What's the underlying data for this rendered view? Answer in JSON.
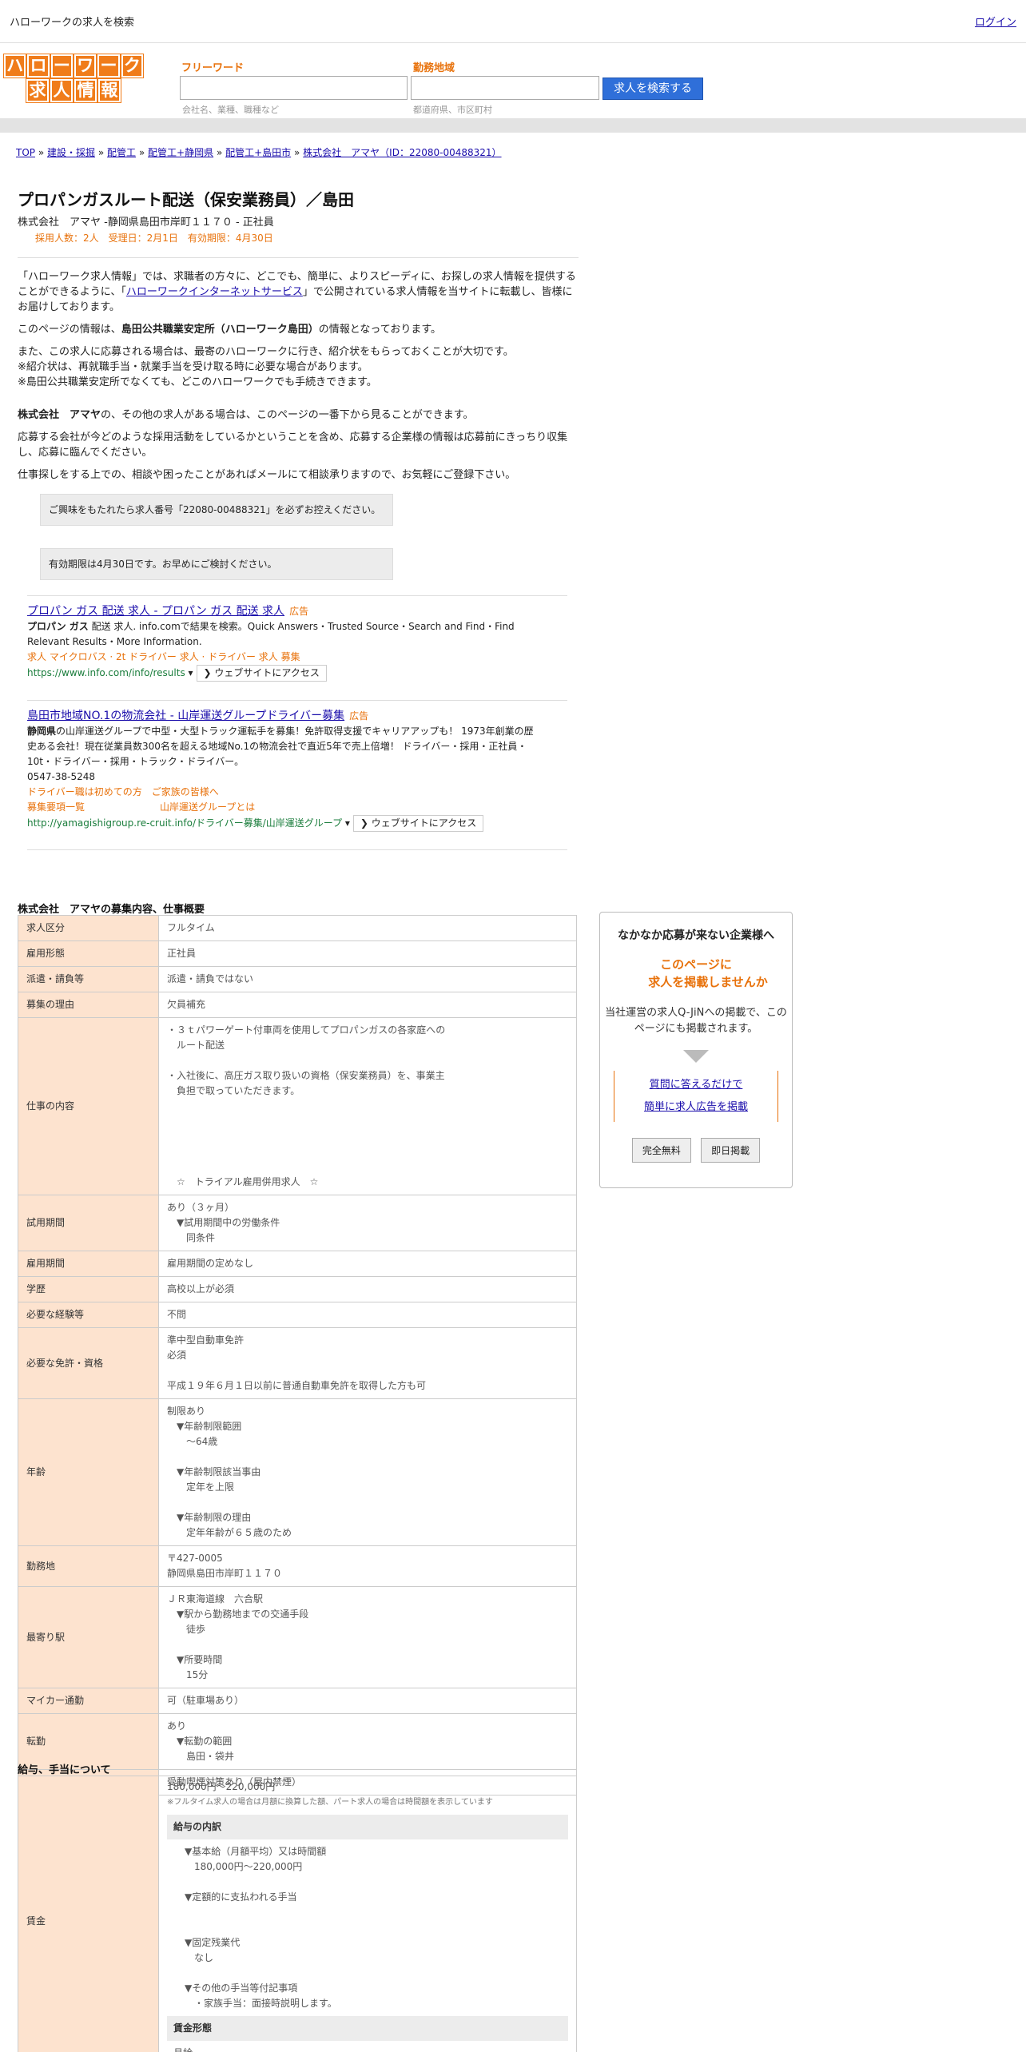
{
  "header": {
    "site_title": "ハローワークの求人を検索",
    "login": "ログイン"
  },
  "logo": {
    "line1": [
      "ハ",
      "ロ",
      "ー",
      "ワ",
      "ー",
      "ク"
    ],
    "line2": [
      "求",
      "人",
      "情",
      "報"
    ]
  },
  "search": {
    "keyword_label": "フリーワード",
    "keyword_hint": "会社名、業種、職種など",
    "area_label": "勤務地域",
    "area_hint": "都道府県、市区町村",
    "button": "求人を検索する"
  },
  "breadcrumb": {
    "items": [
      "TOP",
      "建設・採掘",
      "配管工",
      "配管工+静岡県",
      "配管工+島田市",
      "株式会社　アマヤ（ID：22080-00488321）"
    ],
    "sep": "»"
  },
  "job": {
    "title": "プロパンガスルート配送（保安業務員）／島田",
    "company_line": "株式会社　アマヤ -静岡県島田市岸町１１７０ - 正社員",
    "meta": "採用人数：2人　受理日：2月1日　有効期限：4月30日"
  },
  "intro": {
    "p1a": "「ハローワーク求人情報」では、求職者の方々に、どこでも、簡単に、よりスピーディに、お探しの求人情報を提供することができるように、「",
    "p1link": "ハローワークインターネットサービス",
    "p1b": "」で公開されている求人情報を当サイトに転載し、皆様にお届けしております。",
    "p2a": "このページの情報は、",
    "p2b": "島田公共職業安定所（ハローワーク島田）",
    "p2c": "の情報となっております。",
    "p3": "また、この求人に応募される場合は、最寄のハローワークに行き、紹介状をもらっておくことが大切です。\n※紹介状は、再就職手当・就業手当を受け取る時に必要な場合があります。\n※島田公共職業安定所でなくても、どこのハローワークでも手続きできます。",
    "p4a": "株式会社　アマヤ",
    "p4b": "の、その他の求人がある場合は、このページの一番下から見ることができます。",
    "p5": "応募する会社が今どのような採用活動をしているかということを含め、応募する企業様の情報は応募前にきっちり収集し、応募に臨んでください。",
    "p6": "仕事探しをする上での、相談や困ったことがあればメールにて相談承りますので、お気軽にご登録下さい。"
  },
  "notices": {
    "n1": "ご興味をもたれたら求人番号「22080-00488321」を必ずお控えください。",
    "n2": "有効期限は4月30日です。お早めにご検討ください。"
  },
  "ads": [
    {
      "title": "プロパン ガス 配送 求人 - プロパン ガス 配送 求人",
      "tag": "広告",
      "desc_bold": "プロパン ガス",
      "desc": " 配送 求人. info.comで結果を検索。Quick Answers・Trusted Source・Search and Find・Find Relevant Results・More Information.",
      "links": "求人 マイクロバス · 2t ドライバー 求人 · ドライバー 求人 募集",
      "url": "https://www.info.com/info/results",
      "visit": "❯ ウェブサイトにアクセス"
    },
    {
      "title": "島田市地域NO.1の物流会社 - 山岸運送グループドライバー募集",
      "tag": "広告",
      "desc_bold": "静岡県",
      "desc": "の山岸運送グループで中型・大型トラック運転手を募集！免許取得支援でキャリアアップも！ 1973年創業の歴史ある会社！現在従業員数300名を超える地域No.1の物流会社で直近5年で売上倍増！ ドライバー・採用・正社員・10t・ドライバー・採用・トラック・ドライバー。",
      "phone": "0547-38-5248",
      "sub1": "ドライバー職は初めての方",
      "sub2": "ご家族の皆様へ",
      "sub3": "募集要項一覧",
      "sub4": "山岸運送グループとは",
      "url": "http://yamagishigroup.re-cruit.info/ドライバー募集/山岸運送グループ",
      "visit": "❯ ウェブサイトにアクセス"
    }
  ],
  "details": {
    "section_title": "株式会社　アマヤの募集内容、仕事概要",
    "rows": [
      {
        "k": "求人区分",
        "v": "フルタイム"
      },
      {
        "k": "雇用形態",
        "v": "正社員"
      },
      {
        "k": "派遣・請負等",
        "v": "派遣・請負ではない"
      },
      {
        "k": "募集の理由",
        "v": "欠員補充"
      },
      {
        "k": "仕事の内容",
        "v": "・３ｔパワーゲート付車両を使用してプロパンガスの各家庭への\n　ルート配送\n\n・入社後に、高圧ガス取り扱いの資格（保安業務員）を、事業主\n　負担で取っていただきます。\n\n\n\n\n\n　☆　トライアル雇用併用求人　☆"
      },
      {
        "k": "試用期間",
        "v": "あり（３ヶ月）\n　▼試用期間中の労働条件\n　　同条件"
      },
      {
        "k": "雇用期間",
        "v": "雇用期間の定めなし"
      },
      {
        "k": "学歴",
        "v": "高校以上が必須"
      },
      {
        "k": "必要な経験等",
        "v": "不問"
      },
      {
        "k": "必要な免許・資格",
        "v": "準中型自動車免許\n必須\n\n平成１９年６月１日以前に普通自動車免許を取得した方も可"
      },
      {
        "k": "年齢",
        "v": "制限あり\n　▼年齢制限範囲\n　　〜64歳\n\n　▼年齢制限該当事由\n　　定年を上限\n\n　▼年齢制限の理由\n　　定年年齢が６５歳のため"
      },
      {
        "k": "勤務地",
        "v": "〒427-0005\n静岡県島田市岸町１１７０"
      },
      {
        "k": "最寄り駅",
        "v": "ＪＲ東海道線　六合駅\n　▼駅から勤務地までの交通手段\n　　徒歩\n\n　▼所要時間\n　　15分"
      },
      {
        "k": "マイカー通勤",
        "v": "可（駐車場あり）"
      },
      {
        "k": "転勤",
        "v": "あり\n　▼転勤の範囲\n　　島田・袋井"
      },
      {
        "k": "受動喫煙対策",
        "v": "受動喫煙対策あり（屋内禁煙）"
      }
    ]
  },
  "salary": {
    "section_title": "給与、手当について",
    "label": "賃金",
    "range": "180,000円〜220,000円",
    "note": "※フルタイム求人の場合は月額に換算した額、パート求人の場合は時間額を表示しています",
    "breakdown_title": "給与の内訳",
    "breakdown": "▼基本給（月額平均）又は時間額\n　180,000円〜220,000円\n\n▼定額的に支払われる手当\n\n\n▼固定残業代\n　なし\n\n▼その他の手当等付記事項\n　・家族手当：面接時説明します。",
    "form_title": "賃金形態",
    "form": "月給"
  },
  "sidebox": {
    "title": "なかなか応募が来ない企業様へ",
    "catch1": "このページに",
    "catch2": "求人を掲載しませんか",
    "desc": "当社運営の求人Q-JiNへの掲載で、このページにも掲載されます。",
    "cta1": "質問に答えるだけで",
    "cta2": "簡単に求人広告を掲載",
    "btn1": "完全無料",
    "btn2": "即日掲載"
  }
}
